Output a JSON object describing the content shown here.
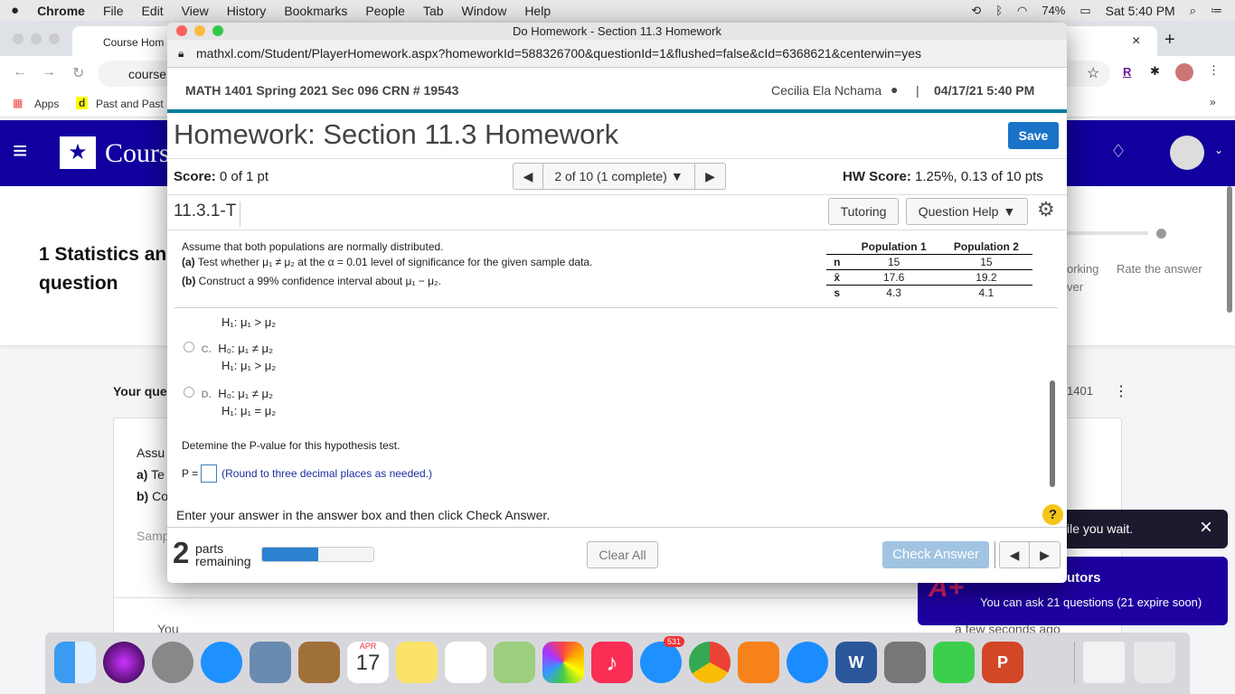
{
  "menubar": {
    "apple": "",
    "app": "Chrome",
    "items": [
      "File",
      "Edit",
      "View",
      "History",
      "Bookmarks",
      "People",
      "Tab",
      "Window",
      "Help"
    ],
    "battery": "74%",
    "clock": "Sat 5:40 PM"
  },
  "chrome": {
    "tab_title": "Course Hom",
    "new_tab": "+",
    "close_tab": "×",
    "url": "course",
    "bookmarks": [
      "Apps",
      "Past and Past"
    ],
    "more": "»",
    "ext_r": "R"
  },
  "coursehero": {
    "logo": "Cours",
    "heading_line1": "1 Statistics and",
    "heading_line2": "question",
    "right_text1": "orking",
    "right_text2": "ver",
    "rate": "Rate the answer",
    "your_question": "Your que",
    "course_code": "1401",
    "q_line1": "Assu",
    "q_line2_b": "a)",
    "q_line2": " Te",
    "q_line3_b": "b)",
    "q_line3": " Co",
    "sample": "Samp",
    "you": "You",
    "ago": "a few seconds ago"
  },
  "toast": {
    "text": "ile you wait.",
    "close": "×"
  },
  "tutors": {
    "title": "utors",
    "text": "You can ask 21 questions (21 expire soon)"
  },
  "popup": {
    "window_title": "Do Homework - Section 11.3 Homework",
    "url": "mathxl.com/Student/PlayerHomework.aspx?homeworkId=588326700&questionId=1&flushed=false&cId=6368621&centerwin=yes",
    "course": "MATH 1401 Spring 2021 Sec 096 CRN # 19543",
    "user": "Cecilia Ela Nchama",
    "datetime": "04/17/21 5:40 PM",
    "title": "Homework: Section 11.3 Homework",
    "save": "Save",
    "score_label": "Score:",
    "score": " 0 of 1 pt",
    "nav_text": "2 of 10 (1 complete)",
    "hw_label": "HW Score:",
    "hw_score": " 1.25%, 0.13 of 10 pts",
    "question_id": "11.3.1-T",
    "tutoring": "Tutoring",
    "question_help": "Question Help",
    "prompt_line1": "Assume that both populations are normally distributed.",
    "prompt_a_label": "(a)",
    "prompt_a": " Test whether μ₁ ≠ μ₂ at the α = 0.01 level of significance for the given sample data.",
    "prompt_b_label": "(b)",
    "prompt_b": " Construct a 99% confidence interval about μ₁ − μ₂.",
    "table": {
      "headers": [
        "",
        "Population 1",
        "Population 2"
      ],
      "rows": [
        [
          "n",
          "15",
          "15"
        ],
        [
          "x̄",
          "17.6",
          "19.2"
        ],
        [
          "s",
          "4.3",
          "4.1"
        ]
      ]
    },
    "optB_h1": "H₁: μ₁ > μ₂",
    "options": [
      {
        "letter": "C.",
        "h0": "H₀: μ₁ ≠ μ₂",
        "h1": "H₁: μ₁ > μ₂"
      },
      {
        "letter": "D.",
        "h0": "H₀: μ₁ ≠ μ₂",
        "h1": "H₁: μ₁ = μ₂"
      }
    ],
    "pvalue_prompt": "Detemine the P-value for this hypothesis test.",
    "p_label": "P =",
    "p_value": "",
    "p_hint": "(Round to three decimal places as needed.)",
    "instructions": "Enter your answer in the answer box and then click Check Answer.",
    "help": "?",
    "parts_count": "2",
    "parts_l1": "parts",
    "parts_l2": "remaining",
    "progress_percent": 50,
    "clear_all": "Clear All",
    "check_answer": "Check Answer"
  },
  "dock": {
    "calendar_month": "APR",
    "calendar_day": "17",
    "mail_badge": "531",
    "word": "W",
    "ppt": "P"
  },
  "colors": {
    "coursehero": "#11009e",
    "mathxl_accent": "#007ea0",
    "save": "#1a73c8",
    "check_disabled": "#a0c4e2",
    "progress": "#2a82d0"
  }
}
